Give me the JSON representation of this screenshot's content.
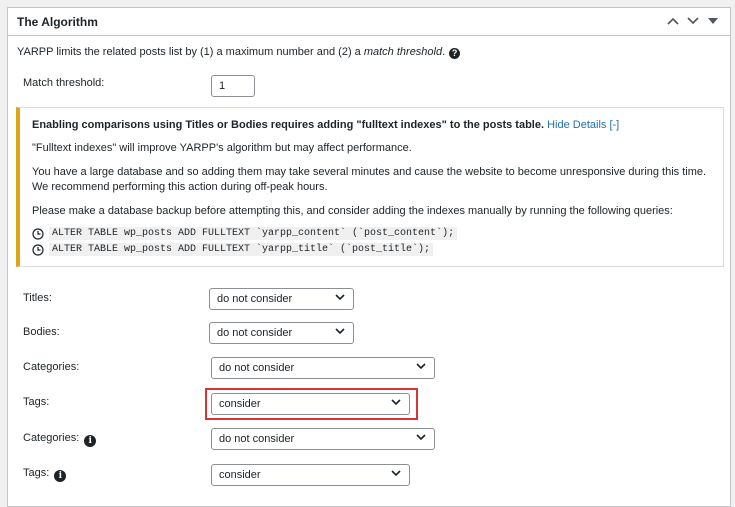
{
  "panel": {
    "title": "The Algorithm",
    "intro_before": "YARPP limits the related posts list by (1) a maximum number and (2) a ",
    "intro_em": "match threshold",
    "intro_after": ".",
    "help_glyph": "?"
  },
  "match_threshold": {
    "label": "Match threshold:",
    "value": "1"
  },
  "notice": {
    "heading": "Enabling comparisons using Titles or Bodies requires adding \"fulltext indexes\" to the posts table.",
    "link": "Hide Details [-]",
    "line1": "\"Fulltext indexes\" will improve YARPP's algorithm but may affect performance.",
    "line2": "You have a large database and so adding them may take several minutes and cause the website to become unresponsive during this time. We recommend performing this action during off-peak hours.",
    "line3": "Please make a database backup before attempting this, and consider adding the indexes manually by running the following queries:",
    "queries": [
      "ALTER TABLE wp_posts ADD FULLTEXT `yarpp_content` (`post_content`);",
      "ALTER TABLE wp_posts ADD FULLTEXT `yarpp_title` (`post_title`);"
    ],
    "accent_color": "#dba617"
  },
  "fields": [
    {
      "label": "Titles:",
      "value": "do not consider"
    },
    {
      "label": "Bodies:",
      "value": "do not consider"
    },
    {
      "label": "Categories:",
      "value": "do not consider"
    },
    {
      "label": "Tags:",
      "value": "consider"
    },
    {
      "label": "Categories:",
      "value": "do not consider"
    },
    {
      "label": "Tags:",
      "value": "consider"
    }
  ],
  "info_glyph": "i",
  "highlight_color": "#d63638"
}
